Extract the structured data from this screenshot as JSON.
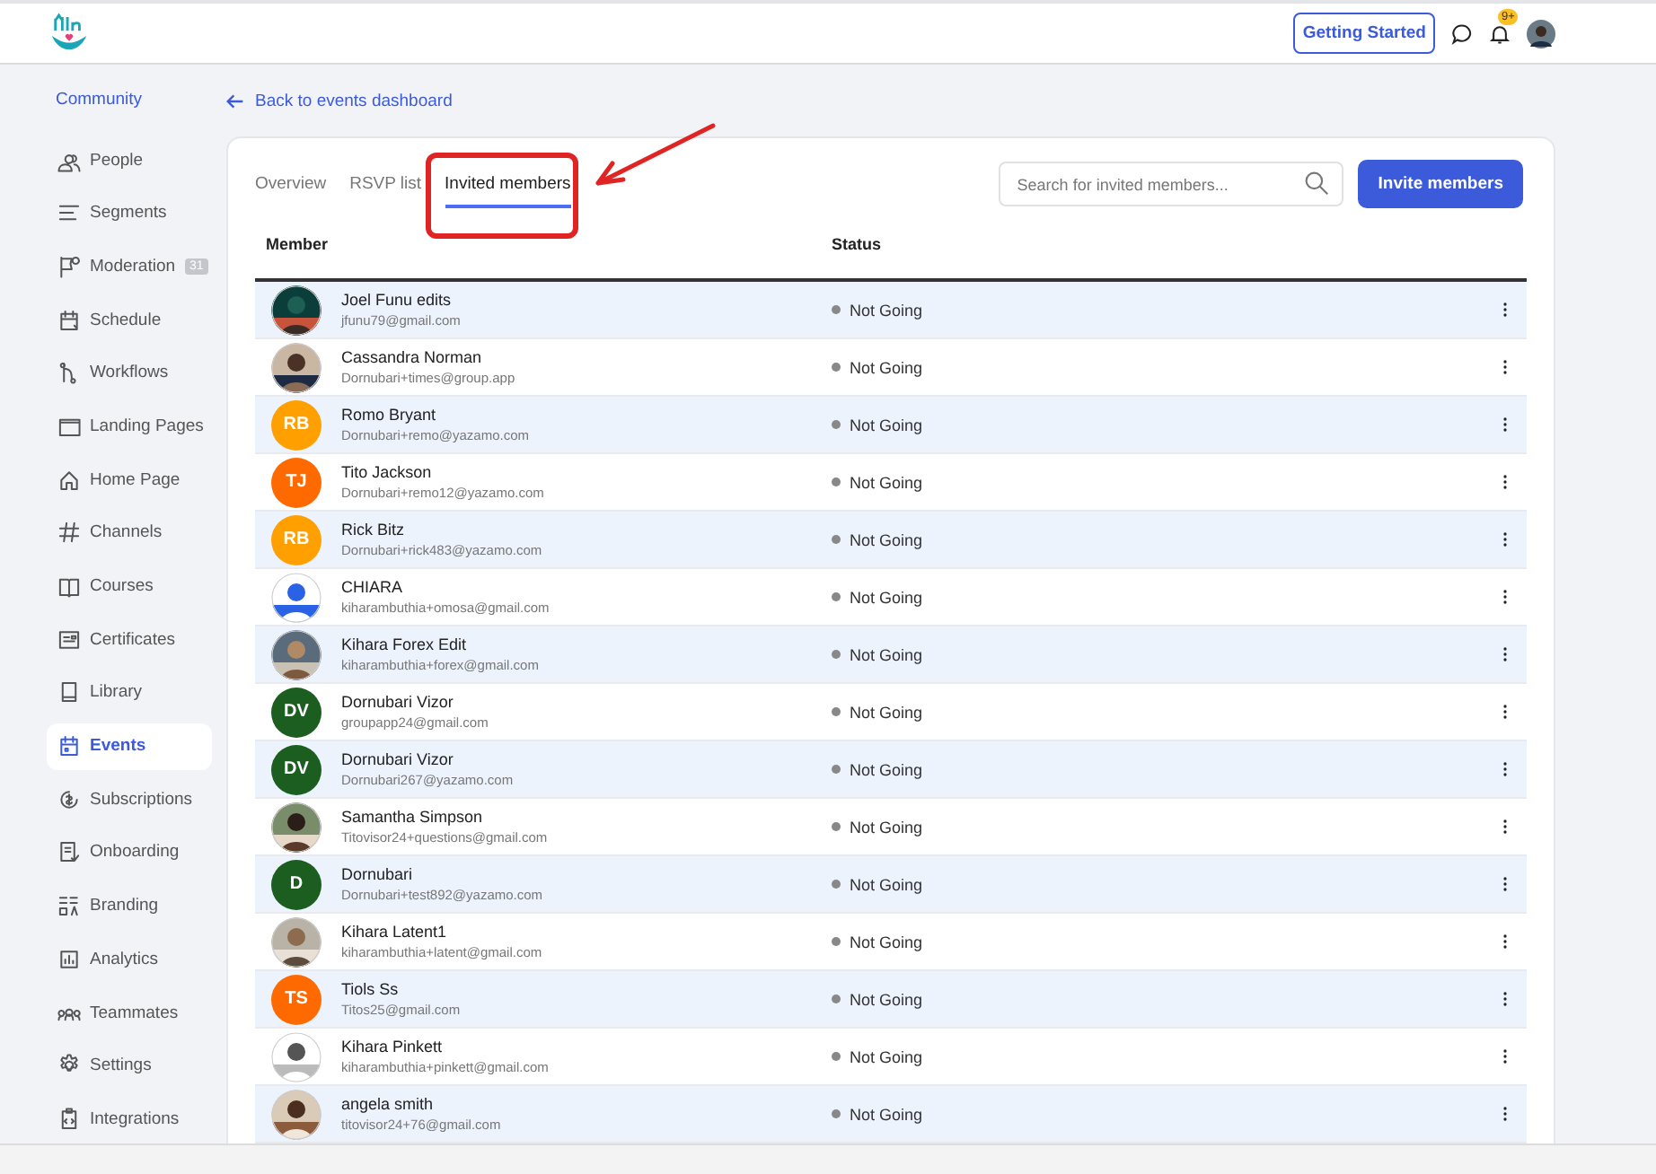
{
  "header": {
    "getting_started": "Getting Started",
    "notification_badge": "9+"
  },
  "sidebar": {
    "title": "Community",
    "items": [
      {
        "label": "People",
        "selected": false
      },
      {
        "label": "Segments",
        "selected": false
      },
      {
        "label": "Moderation",
        "selected": false,
        "badge": "31"
      },
      {
        "label": "Schedule",
        "selected": false
      },
      {
        "label": "Workflows",
        "selected": false
      },
      {
        "label": "Landing Pages",
        "selected": false
      },
      {
        "label": "Home Page",
        "selected": false
      },
      {
        "label": "Channels",
        "selected": false
      },
      {
        "label": "Courses",
        "selected": false
      },
      {
        "label": "Certificates",
        "selected": false
      },
      {
        "label": "Library",
        "selected": false
      },
      {
        "label": "Events",
        "selected": true
      },
      {
        "label": "Subscriptions",
        "selected": false
      },
      {
        "label": "Onboarding",
        "selected": false
      },
      {
        "label": "Branding",
        "selected": false
      },
      {
        "label": "Analytics",
        "selected": false
      },
      {
        "label": "Teammates",
        "selected": false
      },
      {
        "label": "Settings",
        "selected": false
      },
      {
        "label": "Integrations",
        "selected": false
      }
    ]
  },
  "back_link": "Back to events dashboard",
  "tabs": [
    {
      "label": "Overview",
      "selected": false
    },
    {
      "label": "RSVP list",
      "selected": false
    },
    {
      "label": "Invited members",
      "selected": true
    }
  ],
  "search": {
    "placeholder": "Search for invited members..."
  },
  "invite_button": "Invite members",
  "table": {
    "columns": [
      "Member",
      "Status"
    ],
    "rows": [
      {
        "name": "Joel Funu edits",
        "email": "jfunu79@gmail.com",
        "status": "Not Going"
      },
      {
        "name": "Cassandra Norman",
        "email": "Dornubari+times@group.app",
        "status": "Not Going"
      },
      {
        "name": "Romo Bryant",
        "email": "Dornubari+remo@yazamo.com",
        "status": "Not Going",
        "avatar": {
          "kind": "initials",
          "initials": "RB",
          "color": "#ff9f00"
        }
      },
      {
        "name": "Tito Jackson",
        "email": "Dornubari+remo12@yazamo.com",
        "status": "Not Going",
        "avatar": {
          "kind": "initials",
          "initials": "TJ",
          "color": "#ff6a00"
        }
      },
      {
        "name": "Rick Bitz",
        "email": "Dornubari+rick483@yazamo.com",
        "status": "Not Going",
        "avatar": {
          "kind": "initials",
          "initials": "RB",
          "color": "#ff9f00"
        }
      },
      {
        "name": "CHIARA",
        "email": "kiharambuthia+omosa@gmail.com",
        "status": "Not Going"
      },
      {
        "name": "Kihara Forex Edit",
        "email": "kiharambuthia+forex@gmail.com",
        "status": "Not Going"
      },
      {
        "name": "Dornubari Vizor",
        "email": "groupapp24@gmail.com",
        "status": "Not Going",
        "avatar": {
          "kind": "initials",
          "initials": "DV",
          "color": "#1b5e20"
        }
      },
      {
        "name": "Dornubari Vizor",
        "email": "Dornubari267@yazamo.com",
        "status": "Not Going",
        "avatar": {
          "kind": "initials",
          "initials": "DV",
          "color": "#1b5e20"
        }
      },
      {
        "name": "Samantha Simpson",
        "email": "Titovisor24+questions@gmail.com",
        "status": "Not Going"
      },
      {
        "name": "Dornubari",
        "email": "Dornubari+test892@yazamo.com",
        "status": "Not Going",
        "avatar": {
          "kind": "initials",
          "initials": "D",
          "color": "#1b5e20"
        }
      },
      {
        "name": "Kihara Latent1",
        "email": "kiharambuthia+latent@gmail.com",
        "status": "Not Going"
      },
      {
        "name": "Tiols Ss",
        "email": "Titos25@gmail.com",
        "status": "Not Going",
        "avatar": {
          "kind": "initials",
          "initials": "TS",
          "color": "#ff6a00"
        }
      },
      {
        "name": "Kihara Pinkett",
        "email": "kiharambuthia+pinkett@gmail.com",
        "status": "Not Going"
      },
      {
        "name": "angela smith",
        "email": "titovisor24+76@gmail.com",
        "status": "Not Going"
      }
    ]
  }
}
